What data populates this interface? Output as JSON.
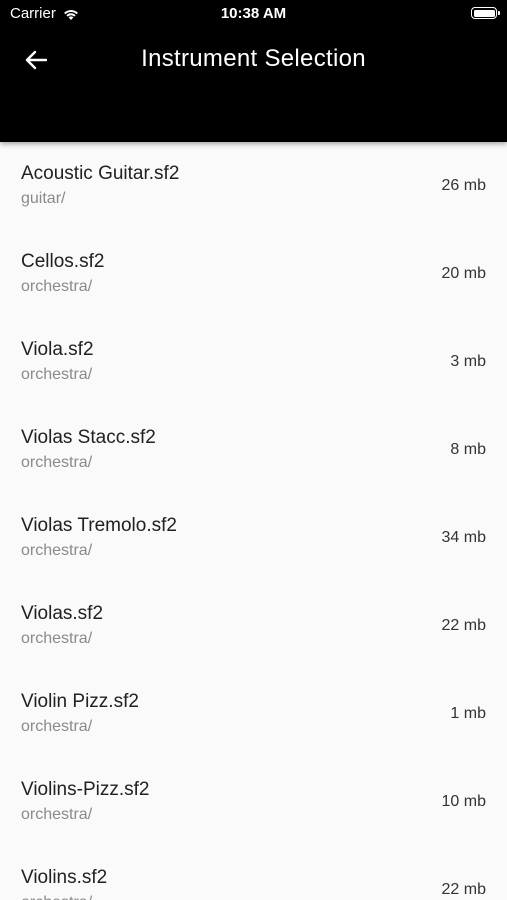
{
  "status_bar": {
    "carrier": "Carrier",
    "time": "10:38 AM"
  },
  "header": {
    "title": "Instrument Selection",
    "back_icon": "arrow-left-icon"
  },
  "instruments": [
    {
      "name": "Acoustic Guitar.sf2",
      "path": "guitar/",
      "size": "26 mb"
    },
    {
      "name": "Cellos.sf2",
      "path": "orchestra/",
      "size": "20 mb"
    },
    {
      "name": "Viola.sf2",
      "path": "orchestra/",
      "size": "3 mb"
    },
    {
      "name": "Violas Stacc.sf2",
      "path": "orchestra/",
      "size": "8 mb"
    },
    {
      "name": "Violas Tremolo.sf2",
      "path": "orchestra/",
      "size": "34 mb"
    },
    {
      "name": "Violas.sf2",
      "path": "orchestra/",
      "size": "22 mb"
    },
    {
      "name": "Violin Pizz.sf2",
      "path": "orchestra/",
      "size": "1 mb"
    },
    {
      "name": "Violins-Pizz.sf2",
      "path": "orchestra/",
      "size": "10 mb"
    },
    {
      "name": "Violins.sf2",
      "path": "orchestra/",
      "size": "22 mb"
    }
  ],
  "colors": {
    "app_bar": "#000000",
    "background": "#fafafa",
    "primary_text": "#212121",
    "secondary_text": "#8a8a8a"
  }
}
